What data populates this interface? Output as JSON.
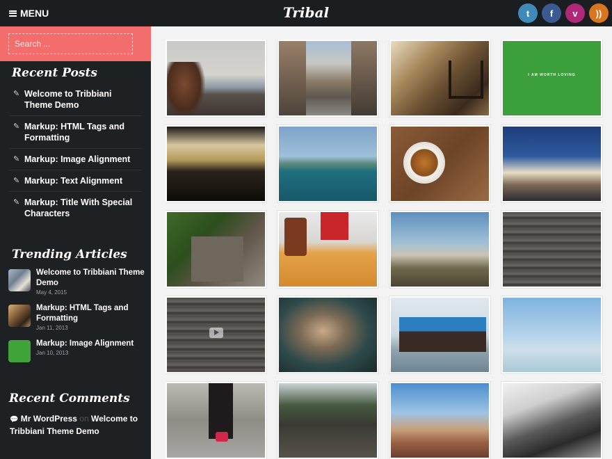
{
  "header": {
    "menu_label": "MENU",
    "site_title": "Tribal",
    "socials": [
      {
        "icon": "twitter-icon",
        "glyph": "t",
        "color": "#3f8ab9"
      },
      {
        "icon": "facebook-icon",
        "glyph": "f",
        "color": "#3c5a92"
      },
      {
        "icon": "vimeo-icon",
        "glyph": "v",
        "color": "#b0277a"
      },
      {
        "icon": "rss-icon",
        "glyph": "))",
        "color": "#d9741f"
      }
    ]
  },
  "sidebar": {
    "search_placeholder": "Search ...",
    "recent_posts": {
      "title": "Recent Posts",
      "items": [
        "Welcome to Tribbiani Theme Demo",
        "Markup: HTML Tags and Formatting",
        "Markup: Image Alignment",
        "Markup: Text Alignment",
        "Markup: Title With Special Characters"
      ]
    },
    "trending": {
      "title": "Trending Articles",
      "items": [
        {
          "title": "Welcome to Tribbiani Theme Demo",
          "date": "May 4, 2015"
        },
        {
          "title": "Markup: HTML Tags and Formatting",
          "date": "Jan 11, 2013"
        },
        {
          "title": "Markup: Image Alignment",
          "date": "Jan 10, 2013"
        }
      ]
    },
    "recent_comments": {
      "title": "Recent Comments",
      "author": "Mr WordPress",
      "connector": "on",
      "post": "Welcome to Tribbiani Theme Demo"
    }
  },
  "gallery": {
    "items": [
      {
        "name": "woman-mountains-photo"
      },
      {
        "name": "city-street-photo"
      },
      {
        "name": "bench-sidewalk-photo"
      },
      {
        "name": "green-quote-image",
        "text": "I AM WORTH LOVING"
      },
      {
        "name": "taxi-traffic-photo"
      },
      {
        "name": "lake-shore-photo"
      },
      {
        "name": "coffee-cup-photo"
      },
      {
        "name": "clouds-sky-photo"
      },
      {
        "name": "forest-shed-photo"
      },
      {
        "name": "desk-writing-photo"
      },
      {
        "name": "tree-hillside-photo"
      },
      {
        "name": "wood-planks-photo"
      },
      {
        "name": "wood-video-thumbnail"
      },
      {
        "name": "rainy-window-portrait-photo"
      },
      {
        "name": "ferry-boat-photo"
      },
      {
        "name": "calm-sea-photo"
      },
      {
        "name": "walking-feet-photo"
      },
      {
        "name": "railway-tracks-photo"
      },
      {
        "name": "city-skyline-photo"
      },
      {
        "name": "surfboard-photo"
      }
    ]
  }
}
